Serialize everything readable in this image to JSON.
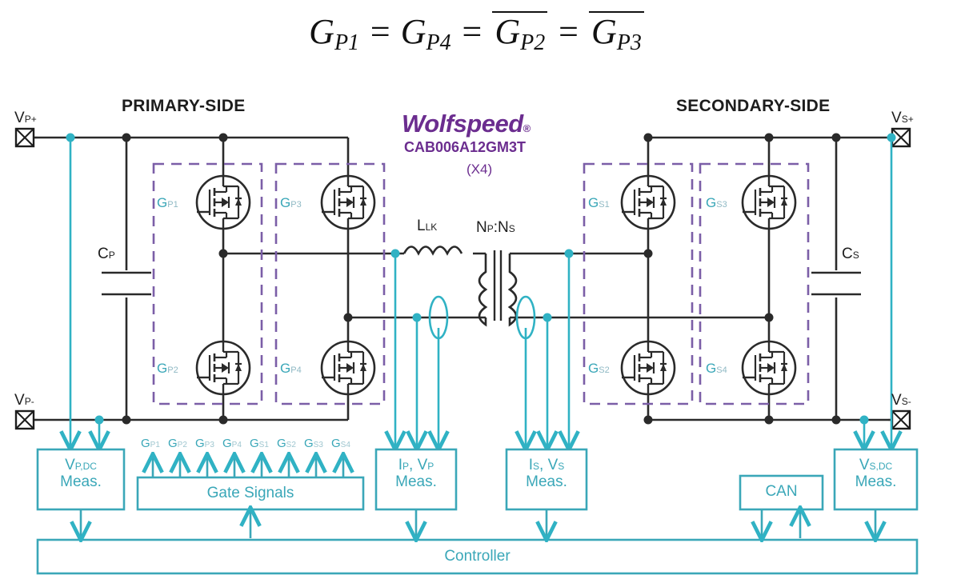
{
  "equation": {
    "terms": [
      "G",
      "P1",
      "G",
      "P4",
      "G",
      "P2",
      "G",
      "P3"
    ],
    "plain": "G_P1 = G_P4 = not(G_P2) = not(G_P3)",
    "eq_symbol": "="
  },
  "headings": {
    "primary": "PRIMARY-SIDE",
    "secondary": "SECONDARY-SIDE"
  },
  "brand": {
    "name": "Wolfspeed",
    "registered": "®",
    "part_number": "CAB006A12GM3T",
    "quantity": "(X4)",
    "color": "#6b2d8f"
  },
  "terminals": [
    {
      "id": "vp_plus",
      "base": "V",
      "sub": "P+"
    },
    {
      "id": "vp_minus",
      "base": "V",
      "sub": "P-"
    },
    {
      "id": "vs_plus",
      "base": "V",
      "sub": "S+"
    },
    {
      "id": "vs_minus",
      "base": "V",
      "sub": "S-"
    }
  ],
  "passives": [
    {
      "id": "cp",
      "base": "C",
      "sub": "P"
    },
    {
      "id": "cs",
      "base": "C",
      "sub": "S"
    },
    {
      "id": "llk",
      "base": "L",
      "sub": "LK"
    }
  ],
  "transformer": {
    "ratio_base": "N",
    "ratio_sub_p": "P",
    "ratio_sub_s": "S",
    "ratio": "N_P:N_S"
  },
  "mosfets": [
    {
      "id": "gp1",
      "base": "G",
      "sub": "P1",
      "side": "primary",
      "position": "top-left"
    },
    {
      "id": "gp3",
      "base": "G",
      "sub": "P3",
      "side": "primary",
      "position": "top-right"
    },
    {
      "id": "gp2",
      "base": "G",
      "sub": "P2",
      "side": "primary",
      "position": "bottom-left"
    },
    {
      "id": "gp4",
      "base": "G",
      "sub": "P4",
      "side": "primary",
      "position": "bottom-right"
    },
    {
      "id": "gs1",
      "base": "G",
      "sub": "S1",
      "side": "secondary",
      "position": "top-left"
    },
    {
      "id": "gs3",
      "base": "G",
      "sub": "S3",
      "side": "secondary",
      "position": "top-right"
    },
    {
      "id": "gs2",
      "base": "G",
      "sub": "S2",
      "side": "secondary",
      "position": "bottom-left"
    },
    {
      "id": "gs4",
      "base": "G",
      "sub": "S4",
      "side": "secondary",
      "position": "bottom-right"
    }
  ],
  "gate_signal_labels": [
    {
      "base": "G",
      "sub": "P1"
    },
    {
      "base": "G",
      "sub": "P2"
    },
    {
      "base": "G",
      "sub": "P3"
    },
    {
      "base": "G",
      "sub": "P4"
    },
    {
      "base": "G",
      "sub": "S1"
    },
    {
      "base": "G",
      "sub": "S2"
    },
    {
      "base": "G",
      "sub": "S3"
    },
    {
      "base": "G",
      "sub": "S4"
    }
  ],
  "blocks": [
    {
      "id": "vp_dc_meas",
      "line1_base": "V",
      "line1_sub": "P,DC",
      "line2": "Meas."
    },
    {
      "id": "gate_signals",
      "line1": "Gate Signals"
    },
    {
      "id": "ip_vp_meas",
      "line1_a": "I",
      "line1_a_sub": "P",
      "line1_b": "V",
      "line1_b_sub": "P",
      "line2": "Meas."
    },
    {
      "id": "is_vs_meas",
      "line1_a": "I",
      "line1_a_sub": "S",
      "line1_b": "V",
      "line1_b_sub": "S",
      "line2": "Meas."
    },
    {
      "id": "can",
      "line1": "CAN"
    },
    {
      "id": "vs_dc_meas",
      "line1_base": "V",
      "line1_sub": "S,DC",
      "line2": "Meas."
    },
    {
      "id": "controller",
      "line1": "Controller"
    }
  ],
  "colors": {
    "teal": "#3aa7b8",
    "teal_line": "#30b2c4",
    "purple": "#7b5ea7",
    "brand_purple": "#6b2d8f",
    "wire": "#2a2a2a",
    "background": "#ffffff"
  }
}
